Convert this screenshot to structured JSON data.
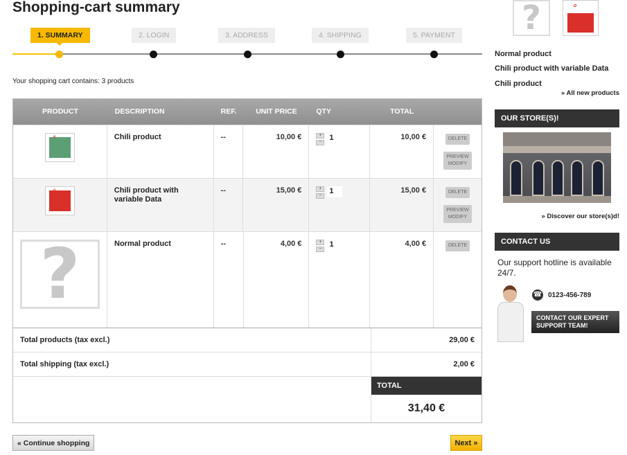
{
  "page": {
    "title": "Shopping-cart summary"
  },
  "steps": [
    {
      "label": "1. SUMMARY",
      "active": true
    },
    {
      "label": "2. LOGIN",
      "active": false
    },
    {
      "label": "3. ADDRESS",
      "active": false
    },
    {
      "label": "4. SHIPPING",
      "active": false
    },
    {
      "label": "5. PAYMENT",
      "active": false
    }
  ],
  "cart": {
    "info": "Your shopping cart contains: 3 products",
    "headers": {
      "product": "PRODUCT",
      "description": "DESCRIPTION",
      "ref": "REF.",
      "unit_price": "UNIT PRICE",
      "qty": "QTY",
      "total": "TOTAL"
    },
    "items": [
      {
        "name": "Chili product",
        "ref": "--",
        "unit_price": "10,00 €",
        "qty": "1",
        "total": "10,00 €",
        "actions": [
          "DELETE",
          "PREVIEW",
          "MODIFY"
        ]
      },
      {
        "name": "Chili product with variable Data",
        "ref": "--",
        "unit_price": "15,00 €",
        "qty": "1",
        "total": "15,00 €",
        "actions": [
          "DELETE",
          "PREVIEW",
          "MODIFY"
        ]
      },
      {
        "name": "Normal product",
        "ref": "--",
        "unit_price": "4,00 €",
        "qty": "1",
        "total": "4,00 €",
        "actions": [
          "DELETE"
        ]
      }
    ],
    "qty_plus": "+",
    "qty_minus": "−",
    "total_products_label": "Total products (tax excl.)",
    "total_products_value": "29,00 €",
    "total_shipping_label": "Total shipping (tax excl.)",
    "total_shipping_value": "2,00 €",
    "total_label": "TOTAL",
    "total_value": "31,40 €",
    "continue_label": "« Continue shopping",
    "next_label": "Next »"
  },
  "sidebar": {
    "new_products": [
      "Normal product",
      "Chili product with variable Data",
      "Chili product"
    ],
    "all_new_label": "» All new products",
    "stores_title": "OUR STORE(S)!",
    "discover_label": "» Discover our store(s)d!",
    "contact_title": "CONTACT US",
    "support_text": "Our support hotline is available 24/7.",
    "phone": "0123-456-789",
    "expert_button": "CONTACT OUR EXPERT SUPPORT TEAM!"
  },
  "colors": {
    "accent": "#f6b800",
    "dark": "#333333",
    "header_grey": "#9a9a9a"
  }
}
